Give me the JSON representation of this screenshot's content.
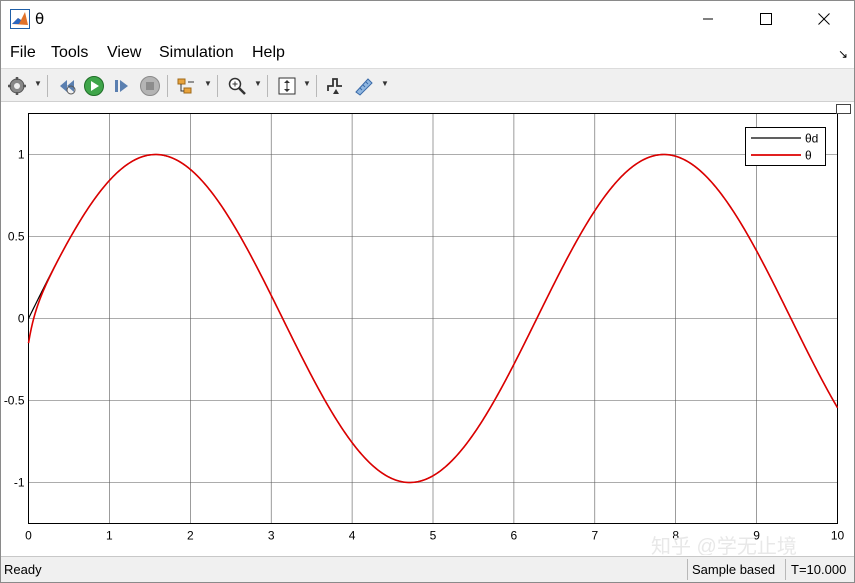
{
  "window": {
    "title": "θ"
  },
  "menu": {
    "file": "File",
    "tools": "Tools",
    "view": "View",
    "simulation": "Simulation",
    "help": "Help"
  },
  "toolbar": {
    "icons": [
      "gear-icon",
      "rewind-icon",
      "run-icon",
      "step-forward-icon",
      "stop-icon",
      "signal-select-icon",
      "zoom-icon",
      "autoscale-icon",
      "triggers-icon",
      "cursor-measure-icon"
    ]
  },
  "status": {
    "ready": "Ready",
    "sample": "Sample based",
    "time": "T=10.000"
  },
  "watermark": "知乎 @学无止境",
  "chart_data": {
    "type": "line",
    "title": "",
    "xlabel": "",
    "ylabel": "",
    "xlim": [
      0,
      10
    ],
    "ylim": [
      -1.25,
      1.25
    ],
    "xticks": [
      0,
      1,
      2,
      3,
      4,
      5,
      6,
      7,
      8,
      9,
      10
    ],
    "xtick_labels": [
      "0",
      "1",
      "2",
      "3",
      "4",
      "5",
      "6",
      "7",
      "8",
      "9",
      "10"
    ],
    "yticks": [
      -1,
      -0.5,
      0,
      0.5,
      1
    ],
    "ytick_labels": [
      "-1",
      "-0.5",
      "0",
      "0.5",
      "1"
    ],
    "grid": true,
    "legend": "top-right",
    "series": [
      {
        "name": "θd",
        "color": "#000000",
        "function": "sin(t)",
        "x_range": [
          0,
          10
        ]
      },
      {
        "name": "θ",
        "color": "#dd0000",
        "function": "sin(t) with initial transient",
        "initial_value": -0.15,
        "converges_by": 0.3,
        "x_range": [
          0,
          10
        ]
      }
    ]
  }
}
